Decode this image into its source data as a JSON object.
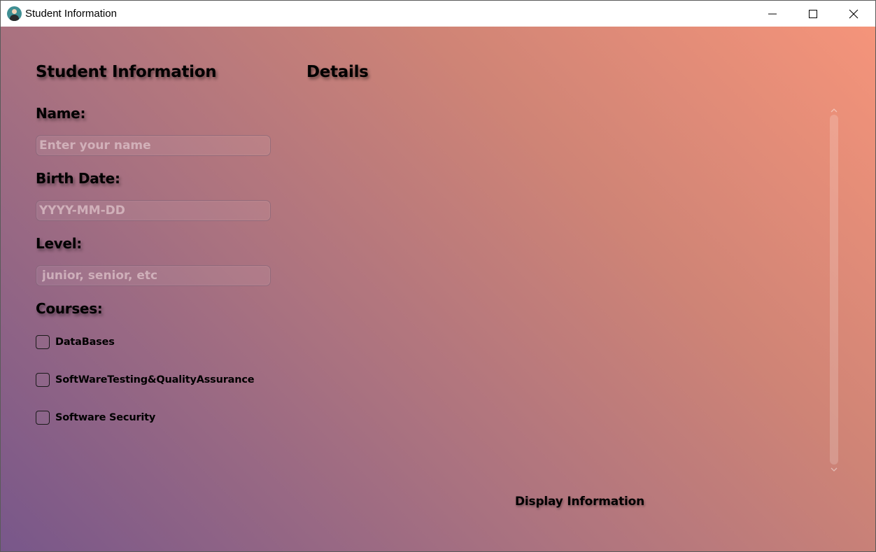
{
  "window": {
    "title": "Student Information",
    "app_icon": "student-avatar-icon",
    "controls": [
      "minimize-icon",
      "maximize-icon",
      "close-icon"
    ]
  },
  "form": {
    "heading": "Student Information",
    "name_label": "Name:",
    "name_placeholder": "Enter your name",
    "name_value": "",
    "birth_label": "Birth Date:",
    "birth_placeholder": "YYYY-MM-DD",
    "birth_value": "",
    "level_label": "Level:",
    "level_placeholder": "junior, senior, etc",
    "level_value": "",
    "courses_label": "Courses:",
    "courses": [
      {
        "label": "DataBases",
        "checked": false
      },
      {
        "label": "SoftWareTesting&QualityAssurance",
        "checked": false
      },
      {
        "label": "Software Security",
        "checked": false
      }
    ]
  },
  "details": {
    "heading": "Details",
    "content": ""
  },
  "actions": {
    "display_label": "Display Information"
  },
  "colors": {
    "gradient_start": "#78578a",
    "gradient_end": "#f5947a"
  }
}
